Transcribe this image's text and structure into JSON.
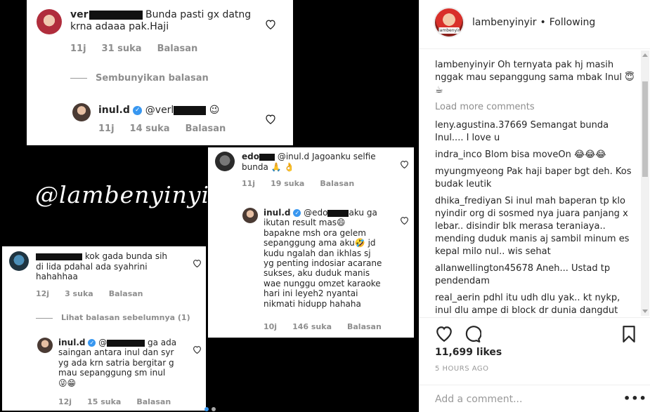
{
  "post_image": {
    "watermark": "@lambenyinyir",
    "card1": {
      "comment": {
        "user": "ver",
        "text_line1": "Bunda pasti gx datng",
        "text_line2": "krna adaaa pak.Haji",
        "time": "11j",
        "likes": "31 suka",
        "reply": "Balasan"
      },
      "hide_replies": "Sembunyikan balasan",
      "reply": {
        "user": "inul.d",
        "mention": "@verl",
        "emoji": "😉",
        "time": "11j",
        "likes": "14 suka",
        "reply": "Balasan"
      }
    },
    "card2": {
      "comment": {
        "user": "edo",
        "mention": "@inul.d",
        "text_line1": "Jagoanku selfie",
        "text_line2": "bunda 🙏 👌",
        "time": "11j",
        "likes": "19 suka",
        "reply": "Balasan"
      },
      "reply": {
        "user": "inul.d",
        "mention": "@edo",
        "lines": [
          "aku ga",
          "ikutan result mas😄",
          "bapakne msh ora gelem",
          "sepanggung ama aku🤣 jd",
          "kudu ngalah dan ikhlas sj",
          "yg penting indosiar acarane",
          "sukses, aku duduk manis",
          "wae nunggu omzet karaoke",
          "hari ini leyeh2 nyantai",
          "nikmati hidupp hahaha"
        ],
        "time": "10j",
        "likes": "146 suka",
        "reply": "Balasan"
      }
    },
    "card3": {
      "comment": {
        "text_line1": "kok gada bunda sih",
        "text_line2": "di lida pdahal ada syahrini",
        "text_line3": "hahahhaa",
        "time": "12j",
        "likes": "3 suka",
        "reply": "Balasan"
      },
      "view_previous": "Lihat balasan sebelumnya (1)",
      "reply": {
        "user": "inul.d",
        "mention": "@",
        "lines": [
          "ga ada",
          "saingan antara inul dan syr",
          "yg ada krn satria bergitar g",
          "mau sepanggung sm inul",
          "😜😁"
        ],
        "time": "12j",
        "likes": "15 suka",
        "reply": "Balasan"
      }
    }
  },
  "header": {
    "username": "lambenyinyir",
    "separator": "•",
    "follow_status": "Following",
    "avatar_badge": "lambenyinyir"
  },
  "caption": {
    "username": "lambenyinyir",
    "text": "Oh ternyata pak hj masih nggak mau sepanggung sama mbak Inul 😇☕"
  },
  "load_more": "Load more comments",
  "comments": [
    {
      "user": "leny.agustina.37669",
      "text": "Semangat bunda Inul.... I love u"
    },
    {
      "user": "indra_inco",
      "text": "Blom bisa moveOn 😂😂😂"
    },
    {
      "user": "myungmyeong",
      "text": "Pak haji baper bgt deh. Kos budak leutik"
    },
    {
      "user": "dhika_frediyan",
      "text": "Si inul mah baperan tp klo nyindir org di sosmed nya juara panjang x lebar.. disindir blk merasa teraniaya.. mending duduk manis aj sambil minum es kepal milo nul.. wis sehat"
    },
    {
      "user": "allanwellington45678",
      "text": "Aneh... Ustad tp pendendam"
    },
    {
      "user": "real_aerin",
      "text": "pdhl itu udh dlu yak.. kt nykp, inul dlu ampe di block dr dunia dangdut"
    }
  ],
  "likes": "11,699 likes",
  "time_ago": "5 HOURS AGO",
  "add_comment": {
    "placeholder": "Add a comment..."
  },
  "more_options": "•••",
  "colors": {
    "verified": "#3897f0",
    "meta_gray": "#8e8e8e",
    "border": "#efefef"
  }
}
